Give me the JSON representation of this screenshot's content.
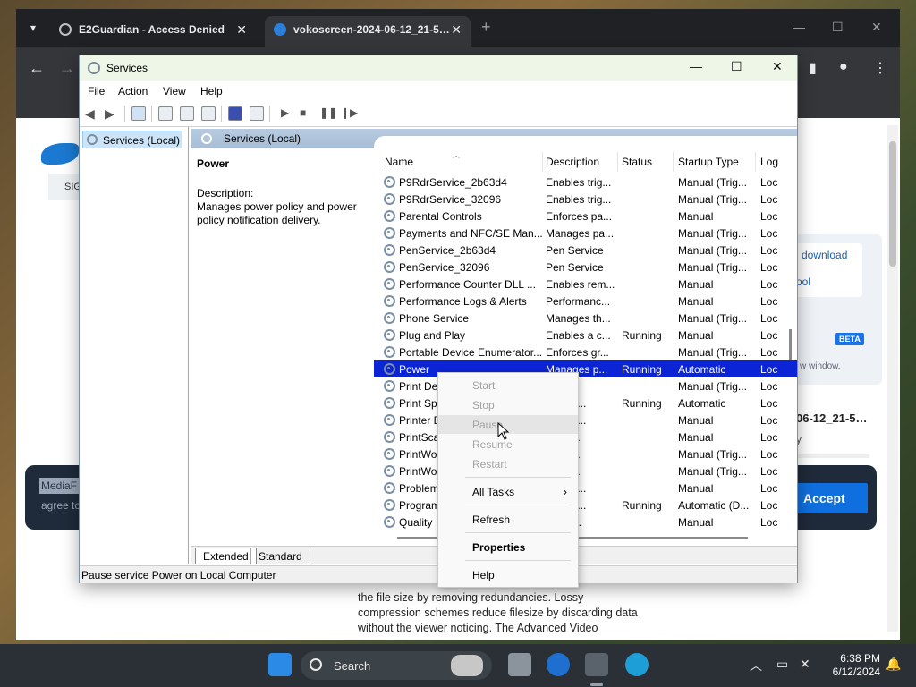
{
  "browser": {
    "tabs": [
      {
        "title": "E2Guardian - Access Denied",
        "close": "✕"
      },
      {
        "title": "vokoscreen-2024-06-12_21-5…",
        "close": "✕"
      }
    ],
    "new_tab": "+",
    "window_controls": {
      "minimize": "—",
      "maximize": "☐",
      "close": "✕"
    },
    "nav": {
      "back": "←",
      "forward": "→"
    }
  },
  "webpage": {
    "sign_tab": "SIG",
    "side_download": "download",
    "side_tool": "ool",
    "beta": "BETA",
    "new_window": "w window.",
    "file_name": "06-12_21-5…",
    "file_sub": "y",
    "cookie_line1": "MediaF",
    "cookie_line2": "agree to",
    "accept": "Accept",
    "body_text": "the file size by removing redundancies. Lossy compression schemes reduce filesize by discarding data without the viewer noticing. The Advanced Video"
  },
  "services": {
    "title": "Services",
    "window_controls": {
      "minimize": "—",
      "maximize": "☐",
      "close": "✕"
    },
    "menu": [
      "File",
      "Action",
      "View",
      "Help"
    ],
    "tree_item": "Services (Local)",
    "header": "Services (Local)",
    "selected_name": "Power",
    "description_label": "Description:",
    "description_text": "Manages power policy and power policy notification delivery.",
    "columns": [
      "Name",
      "Description",
      "Status",
      "Startup Type",
      "Log"
    ],
    "rows": [
      {
        "name": "P9RdrService_2b63d4",
        "desc": "Enables trig...",
        "status": "",
        "startup": "Manual (Trig...",
        "log": "Loc"
      },
      {
        "name": "P9RdrService_32096",
        "desc": "Enables trig...",
        "status": "",
        "startup": "Manual (Trig...",
        "log": "Loc"
      },
      {
        "name": "Parental Controls",
        "desc": "Enforces pa...",
        "status": "",
        "startup": "Manual",
        "log": "Loc"
      },
      {
        "name": "Payments and NFC/SE Man...",
        "desc": "Manages pa...",
        "status": "",
        "startup": "Manual (Trig...",
        "log": "Loc"
      },
      {
        "name": "PenService_2b63d4",
        "desc": "Pen Service",
        "status": "",
        "startup": "Manual (Trig...",
        "log": "Loc"
      },
      {
        "name": "PenService_32096",
        "desc": "Pen Service",
        "status": "",
        "startup": "Manual (Trig...",
        "log": "Loc"
      },
      {
        "name": "Performance Counter DLL ...",
        "desc": "Enables rem...",
        "status": "",
        "startup": "Manual",
        "log": "Loc"
      },
      {
        "name": "Performance Logs & Alerts",
        "desc": "Performanc...",
        "status": "",
        "startup": "Manual",
        "log": "Loc"
      },
      {
        "name": "Phone Service",
        "desc": "Manages th...",
        "status": "",
        "startup": "Manual (Trig...",
        "log": "Loc"
      },
      {
        "name": "Plug and Play",
        "desc": "Enables a c...",
        "status": "Running",
        "startup": "Manual",
        "log": "Loc"
      },
      {
        "name": "Portable Device Enumerator...",
        "desc": "Enforces gr...",
        "status": "",
        "startup": "Manual (Trig...",
        "log": "Loc"
      },
      {
        "name": "Power",
        "desc": "Manages p...",
        "status": "Running",
        "startup": "Automatic",
        "log": "Loc"
      },
      {
        "name": "Print De",
        "desc": "int D...",
        "status": "",
        "startup": "Manual (Trig...",
        "log": "Loc"
      },
      {
        "name": "Print Sp",
        "desc": "ervice ...",
        "status": "Running",
        "startup": "Automatic",
        "log": "Loc"
      },
      {
        "name": "Printer E",
        "desc": "ervice ...",
        "status": "",
        "startup": "Manual",
        "log": "Loc"
      },
      {
        "name": "PrintSca",
        "desc": "es su...",
        "status": "",
        "startup": "Manual",
        "log": "Loc"
      },
      {
        "name": "PrintWo",
        "desc": "es su...",
        "status": "",
        "startup": "Manual (Trig...",
        "log": "Loc"
      },
      {
        "name": "PrintWo",
        "desc": "es su...",
        "status": "",
        "startup": "Manual (Trig...",
        "log": "Loc"
      },
      {
        "name": "Problem",
        "desc": "ervice ...",
        "status": "",
        "startup": "Manual",
        "log": "Loc"
      },
      {
        "name": "Program",
        "desc": "ervice ...",
        "status": "Running",
        "startup": "Automatic (D...",
        "log": "Loc"
      },
      {
        "name": "Quality",
        "desc": "y Win...",
        "status": "",
        "startup": "Manual",
        "log": "Loc"
      }
    ],
    "bottom_tabs": [
      "Extended",
      "Standard"
    ],
    "status_text": "Pause service Power on Local Computer"
  },
  "context_menu": {
    "start": "Start",
    "stop": "Stop",
    "pause": "Pause",
    "resume": "Resume",
    "restart": "Restart",
    "all_tasks": "All Tasks",
    "submenu_arrow": "›",
    "refresh": "Refresh",
    "properties": "Properties",
    "help": "Help"
  },
  "taskbar": {
    "search": "Search",
    "time": "6:38 PM",
    "date": "6/12/2024"
  }
}
